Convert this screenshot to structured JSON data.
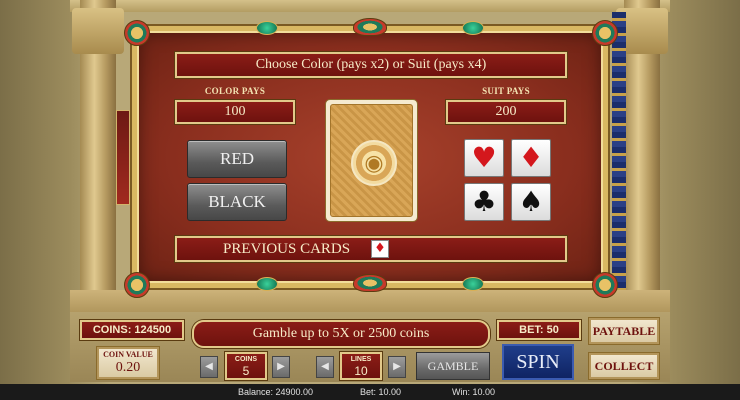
{
  "gamble": {
    "title": "Choose Color (pays x2) or Suit (pays x4)",
    "color_pays_label": "COLOR PAYS",
    "color_pays_value": "100",
    "suit_pays_label": "SUIT PAYS",
    "suit_pays_value": "200",
    "red_label": "RED",
    "black_label": "BLACK",
    "card_emblem": "scarab-icon",
    "suits": {
      "heart": "♥",
      "diamond": "♦",
      "club": "♣",
      "spade": "♠"
    },
    "previous_cards_label": "PREVIOUS CARDS",
    "previous_cards": [
      "♦"
    ]
  },
  "controls": {
    "coins_display": "COINS: 124500",
    "gamble_message": "Gamble up to 5X or 2500 coins",
    "bet_display": "BET: 50",
    "paytable_label": "PAYTABLE",
    "collect_label": "COLLECT",
    "coin_value_label": "COIN VALUE",
    "coin_value": "0.20",
    "coins_label": "COINS",
    "coins_value": "5",
    "lines_label": "LINES",
    "lines_value": "10",
    "gamble_label": "GAMBLE",
    "spin_label": "SPIN",
    "arrow_left": "◀",
    "arrow_right": "▶"
  },
  "status": {
    "balance": "Balance: 24900.00",
    "bet": "Bet: 10.00",
    "win": "Win: 10.00"
  },
  "colors": {
    "panel_red": "#8a2e1e",
    "gold_border": "#d9b862",
    "suit_red": "#d4171d",
    "spin_blue": "#1f3d8a"
  }
}
